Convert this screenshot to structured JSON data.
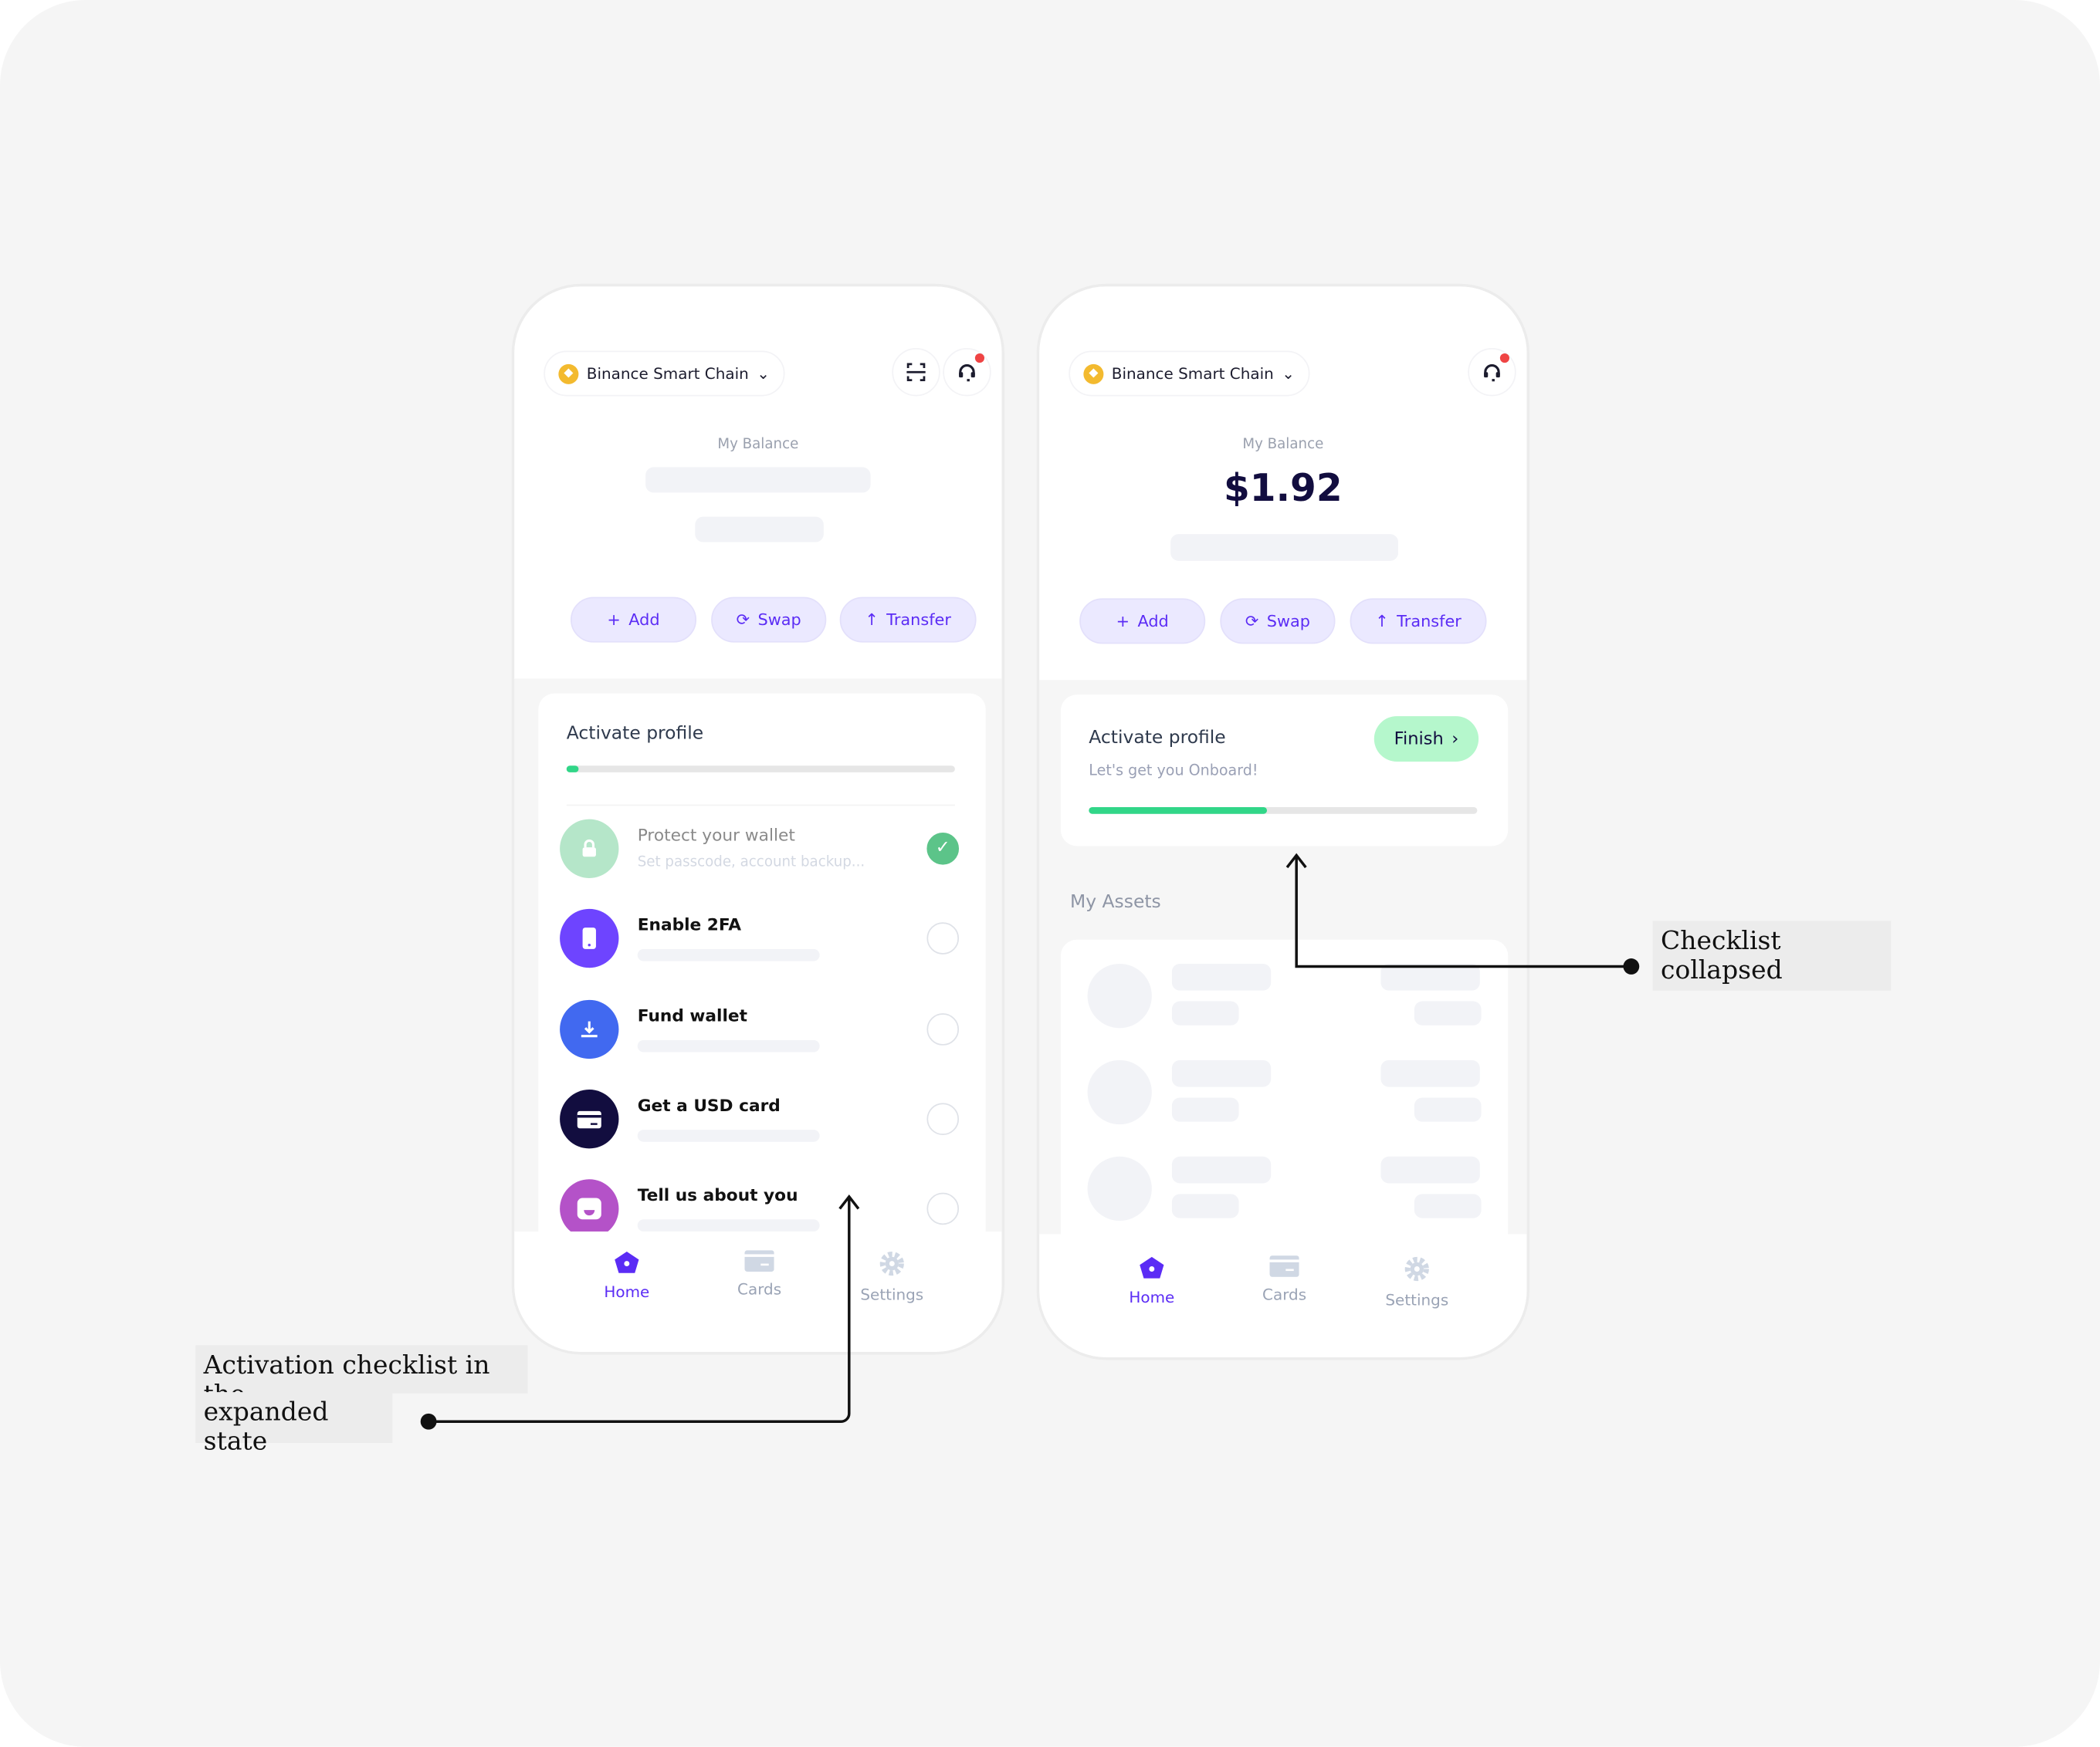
{
  "left_phone": {
    "chain": "Binance Smart Chain",
    "balance_label": "My Balance",
    "actions": [
      "Add",
      "Swap",
      "Transfer"
    ],
    "checklist": {
      "title": "Activate profile",
      "progress_percent": 3,
      "items": [
        {
          "title": "Protect your wallet",
          "subtitle": "Set passcode, account backup...",
          "done": true,
          "icon": "lock-icon",
          "color": "#b5e6c9"
        },
        {
          "title": "Enable 2FA",
          "done": false,
          "icon": "phone-icon",
          "color": "#6e44ff"
        },
        {
          "title": "Fund wallet",
          "done": false,
          "icon": "download-icon",
          "color": "#4169f0"
        },
        {
          "title": "Get a USD card",
          "done": false,
          "icon": "card-icon",
          "color": "#120d3f"
        },
        {
          "title": "Tell us about you",
          "done": false,
          "icon": "smile-icon",
          "color": "#b452c8"
        }
      ]
    },
    "nav": [
      "Home",
      "Cards",
      "Settings"
    ]
  },
  "right_phone": {
    "chain": "Binance Smart Chain",
    "balance_label": "My Balance",
    "balance": "$1.92",
    "actions": [
      "Add",
      "Swap",
      "Transfer"
    ],
    "checklist": {
      "title": "Activate profile",
      "subtitle": "Let's get you Onboard!",
      "finish": "Finish",
      "progress_percent": 46
    },
    "assets_title": "My Assets",
    "nav": [
      "Home",
      "Cards",
      "Settings"
    ]
  },
  "annotations": {
    "collapsed": "Checklist collapsed",
    "expanded_line1": "Activation checklist in the",
    "expanded_line2": "expanded state"
  },
  "colors": {
    "accent": "#5b2cf5",
    "progress": "#31d688",
    "finish_bg": "#b5f7cc",
    "notification": "#ef4444"
  }
}
